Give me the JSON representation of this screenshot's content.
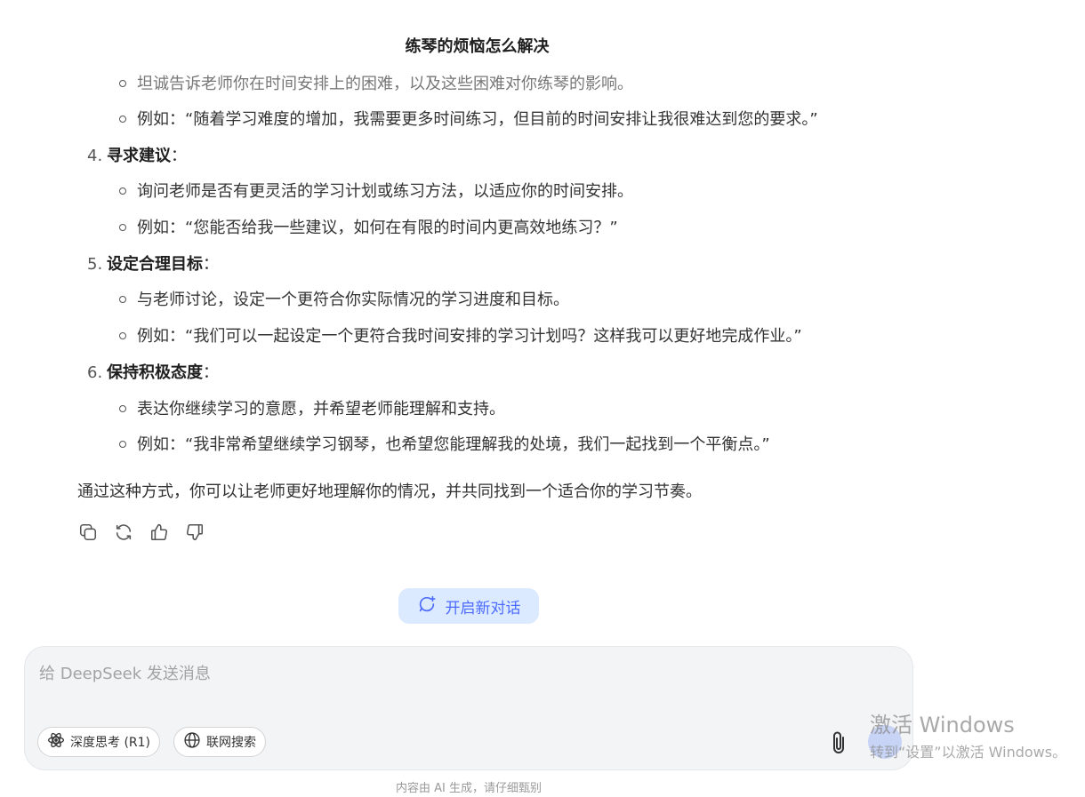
{
  "conversation": {
    "title": "练琴的烦恼怎么解决",
    "items": [
      {
        "kind": "sub",
        "text": "坦诚告诉老师你在时间安排上的困难，以及这些困难对你练琴的影响。",
        "faded": true
      },
      {
        "kind": "sub",
        "text": "例如：“随着学习难度的增加，我需要更多时间练习，但目前的时间安排让我很难达到您的要求。”"
      },
      {
        "kind": "num",
        "n": "4.",
        "bold": "寻求建议",
        "colon": "："
      },
      {
        "kind": "sub",
        "text": "询问老师是否有更灵活的学习计划或练习方法，以适应你的时间安排。"
      },
      {
        "kind": "sub",
        "text": "例如：“您能否给我一些建议，如何在有限的时间内更高效地练习？”"
      },
      {
        "kind": "num",
        "n": "5.",
        "bold": "设定合理目标",
        "colon": "："
      },
      {
        "kind": "sub",
        "text": "与老师讨论，设定一个更符合你实际情况的学习进度和目标。"
      },
      {
        "kind": "sub",
        "text": "例如：“我们可以一起设定一个更符合我时间安排的学习计划吗？这样我可以更好地完成作业。”"
      },
      {
        "kind": "num",
        "n": "6.",
        "bold": "保持积极态度",
        "colon": "："
      },
      {
        "kind": "sub",
        "text": "表达你继续学习的意愿，并希望老师能理解和支持。"
      },
      {
        "kind": "sub",
        "text": "例如：“我非常希望继续学习钢琴，也希望您能理解我的处境，我们一起找到一个平衡点。”"
      }
    ],
    "closing": "通过这种方式，你可以让老师更好地理解你的情况，并共同找到一个适合你的学习节奏。"
  },
  "actions": [
    "copy-icon",
    "regenerate-icon",
    "thumbs-up-icon",
    "thumbs-down-icon"
  ],
  "new_chat": {
    "label": "开启新对话",
    "icon": "chat-plus-icon"
  },
  "composer": {
    "placeholder": "给 DeepSeek 发送消息",
    "deep_think_label": "深度思考 (R1)",
    "web_search_label": "联网搜索",
    "attach_icon": "paperclip-icon",
    "send_icon": "send-icon"
  },
  "disclaimer": "内容由 AI 生成，请仔细甄别",
  "watermark": {
    "line1": "激活 Windows",
    "line2": "转到“设置”以激活 Windows。"
  },
  "colors": {
    "accent": "#4d6bfe",
    "accent_bg": "#dbeafe",
    "composer_bg": "#f3f4f6"
  }
}
